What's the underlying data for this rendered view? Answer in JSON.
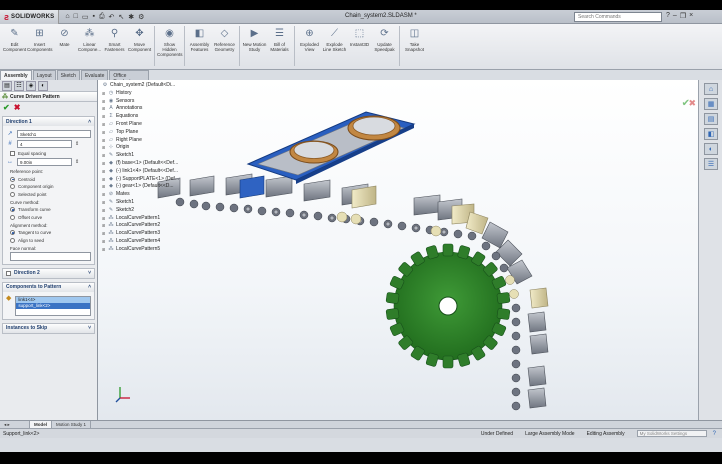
{
  "app": {
    "brand": "SOLIDWORKS",
    "document_title": "Chain_system2.SLDASM *",
    "search_placeholder": "Search Commands"
  },
  "toolbar": {
    "buttons": [
      {
        "label": "Edit Component",
        "icon": "edit-component-icon"
      },
      {
        "label": "Insert Components",
        "icon": "insert-components-icon"
      },
      {
        "label": "Mate",
        "icon": "mate-icon"
      },
      {
        "label": "Linear Compone...",
        "icon": "linear-pattern-icon"
      },
      {
        "label": "Smart Fasteners",
        "icon": "smart-fasteners-icon"
      },
      {
        "label": "Move Component",
        "icon": "move-component-icon"
      },
      {
        "label": "Show Hidden Components",
        "icon": "show-hidden-icon"
      },
      {
        "label": "Assembly Features",
        "icon": "assembly-features-icon"
      },
      {
        "label": "Reference Geometry",
        "icon": "reference-geometry-icon"
      },
      {
        "label": "New Motion Study",
        "icon": "motion-study-icon"
      },
      {
        "label": "Bill of Materials",
        "icon": "bom-icon"
      },
      {
        "label": "Exploded View",
        "icon": "exploded-view-icon"
      },
      {
        "label": "Explode Line Sketch",
        "icon": "explode-line-icon"
      },
      {
        "label": "Instant3D",
        "icon": "instant3d-icon"
      },
      {
        "label": "Update Speedpak",
        "icon": "speedpak-icon"
      },
      {
        "label": "Take Snapshot",
        "icon": "snapshot-icon"
      }
    ]
  },
  "tabs": [
    "Assembly",
    "Layout",
    "Sketch",
    "Evaluate",
    "Office Products"
  ],
  "property_manager": {
    "title": "Curve Driven Pattern",
    "direction1": {
      "title": "Direction 1",
      "path_value": "Sketch1",
      "instances_value": "4",
      "equal_spacing_label": "Equal spacing",
      "spacing_value": "9.00in",
      "reference_point_label": "Reference point:",
      "reference_options": [
        "Centroid",
        "Component origin",
        "Selected point"
      ],
      "curve_method_label": "Curve method:",
      "curve_options": [
        "Transform curve",
        "Offset curve"
      ],
      "alignment_label": "Alignment method:",
      "alignment_options": [
        "Tangent to curve",
        "Align to seed"
      ],
      "face_normal_label": "Face normal:"
    },
    "direction2": {
      "title": "Direction 2"
    },
    "components": {
      "title": "Components to Pattern",
      "items": [
        "link1<4>",
        "support_link<2>"
      ]
    },
    "instances_to_skip": {
      "title": "Instances to Skip"
    }
  },
  "feature_tree": {
    "root": "Chain_system2 (Default<Di...",
    "items": [
      {
        "label": "History",
        "icon": "history-icon"
      },
      {
        "label": "Sensors",
        "icon": "sensor-icon"
      },
      {
        "label": "Annotations",
        "icon": "annotations-icon"
      },
      {
        "label": "Equations",
        "icon": "equations-icon"
      },
      {
        "label": "Front Plane",
        "icon": "plane-icon"
      },
      {
        "label": "Top Plane",
        "icon": "plane-icon"
      },
      {
        "label": "Right Plane",
        "icon": "plane-icon"
      },
      {
        "label": "Origin",
        "icon": "origin-icon"
      },
      {
        "label": "Sketch1",
        "icon": "sketch-icon"
      },
      {
        "label": "(f) base<1> (Default<<Def...",
        "icon": "part-icon"
      },
      {
        "label": "(-) link1<4> (Default<<Def...",
        "icon": "part-icon"
      },
      {
        "label": "(-) SupportPLATE<1> (Def...",
        "icon": "part-icon"
      },
      {
        "label": "(-) gear<1> (Default<<D...",
        "icon": "part-icon"
      },
      {
        "label": "Mates",
        "icon": "mates-icon"
      },
      {
        "label": "Sketch1",
        "icon": "sketch-icon"
      },
      {
        "label": "Sketch2",
        "icon": "sketch-icon"
      },
      {
        "label": "LocalCurvePattern1",
        "icon": "pattern-icon"
      },
      {
        "label": "LocalCurvePattern2",
        "icon": "pattern-icon"
      },
      {
        "label": "LocalCurvePattern3",
        "icon": "pattern-icon"
      },
      {
        "label": "LocalCurvePattern4",
        "icon": "pattern-icon"
      },
      {
        "label": "LocalCurvePattern5",
        "icon": "pattern-icon"
      }
    ]
  },
  "bottom_tabs": [
    "Model",
    "Motion Study 1"
  ],
  "status": {
    "selection": "Support_link<2>",
    "state1": "Under Defined",
    "state2": "Large Assembly Mode",
    "state3": "Editing Assembly",
    "user_placeholder": "My SolidWorks Settings"
  },
  "colors": {
    "gear": "#2f7d2a",
    "plate": "#2458b8",
    "bearing": "#b8783c",
    "link": "#8a8f99",
    "roller": "#d8cfa0"
  }
}
